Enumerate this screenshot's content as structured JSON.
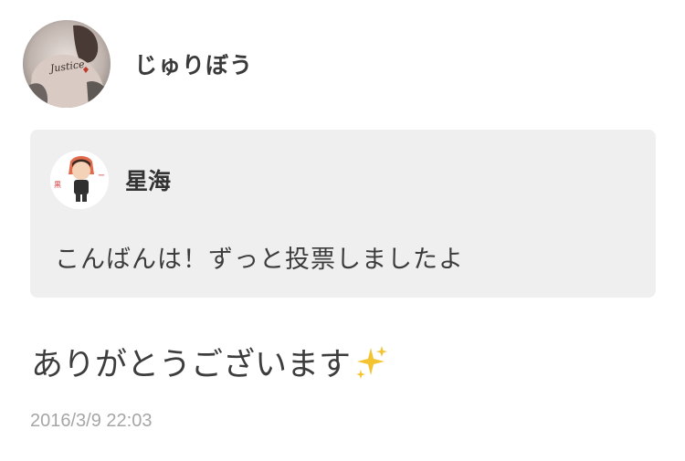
{
  "comment": {
    "author": "じゅりぼう",
    "avatar_icon": "user-avatar-photo",
    "quote": {
      "author": "星海",
      "avatar_icon": "anime-character-avatar",
      "text": "こんばんは！ずっと投票しましたよ"
    },
    "reply_text": "ありがとうございます",
    "reply_emoji": "sparkles-icon",
    "timestamp": "2016/3/9 22:03"
  },
  "colors": {
    "quote_background": "#efefef",
    "timestamp": "#a6a6a6",
    "text": "#333333",
    "sparkle": "#f4c430"
  }
}
